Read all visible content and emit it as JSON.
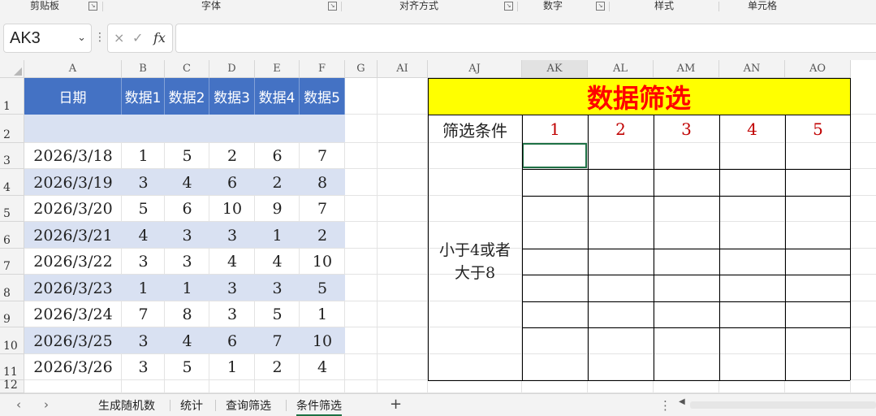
{
  "ribbon": {
    "groups": [
      "剪贴板",
      "字体",
      "对齐方式",
      "数字",
      "样式",
      "单元格"
    ]
  },
  "formula_bar": {
    "name_box": "AK3",
    "cancel_icon": "×",
    "enter_icon": "✓",
    "fx_label": "fx",
    "formula": ""
  },
  "columns": [
    "A",
    "B",
    "C",
    "D",
    "E",
    "F",
    "G",
    "AI",
    "AJ",
    "AK",
    "AL",
    "AM",
    "AN",
    "AO"
  ],
  "rows": [
    "1",
    "2",
    "3",
    "4",
    "5",
    "6",
    "7",
    "8",
    "9",
    "10",
    "11",
    "12"
  ],
  "data_table": {
    "headers": [
      "日期",
      "数据1",
      "数据2",
      "数据3",
      "数据4",
      "数据5"
    ],
    "rows": [
      [
        "2026/3/18",
        "1",
        "5",
        "2",
        "6",
        "7"
      ],
      [
        "2026/3/19",
        "3",
        "4",
        "6",
        "2",
        "8"
      ],
      [
        "2026/3/20",
        "5",
        "6",
        "10",
        "9",
        "7"
      ],
      [
        "2026/3/21",
        "4",
        "3",
        "3",
        "1",
        "2"
      ],
      [
        "2026/3/22",
        "3",
        "3",
        "4",
        "4",
        "10"
      ],
      [
        "2026/3/23",
        "1",
        "1",
        "3",
        "3",
        "5"
      ],
      [
        "2026/3/24",
        "7",
        "8",
        "3",
        "5",
        "1"
      ],
      [
        "2026/3/25",
        "3",
        "4",
        "6",
        "7",
        "10"
      ],
      [
        "2026/3/26",
        "3",
        "5",
        "1",
        "2",
        "4"
      ]
    ]
  },
  "filter_panel": {
    "title": "数据筛选",
    "label": "筛选条件",
    "numbers": [
      "1",
      "2",
      "3",
      "4",
      "5"
    ],
    "condition": "小于4或者大于8",
    "title_bg": "#ffff00",
    "title_color": "#ff0000",
    "number_color": "#c00000"
  },
  "sheet_tabs": {
    "tabs": [
      "生成随机数",
      "统计",
      "查询筛选",
      "条件筛选"
    ],
    "active_index": 3,
    "add": "+"
  },
  "colors": {
    "header_blue": "#4472c4",
    "band_blue": "#d9e1f2"
  }
}
